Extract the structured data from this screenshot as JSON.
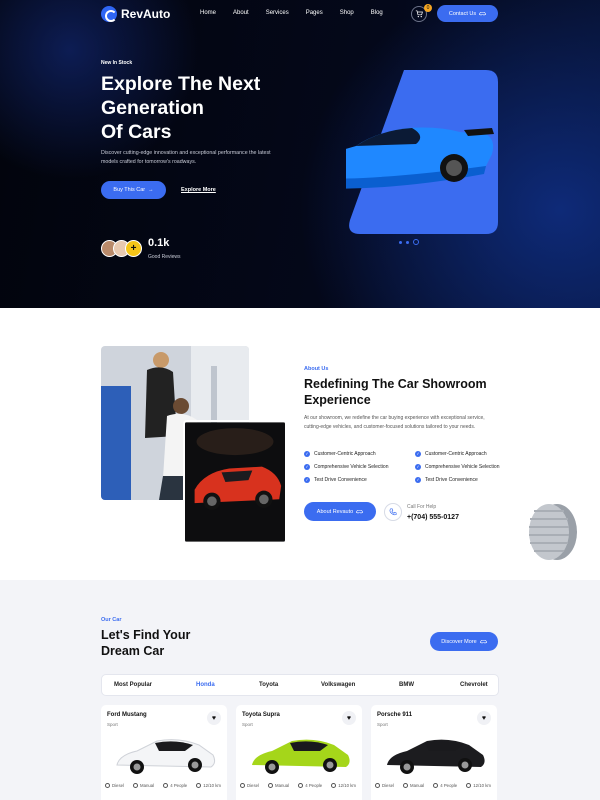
{
  "brand": {
    "name": "RevAuto",
    "accent": "#3b6cf0"
  },
  "nav": {
    "items": [
      "Home",
      "About",
      "Services",
      "Pages",
      "Shop",
      "Blog"
    ],
    "cart_count": "0",
    "contact_label": "Contact Us"
  },
  "hero": {
    "eyebrow": "New In Stock",
    "title_lines": [
      "Explore The Next",
      "Generation",
      "Of Cars"
    ],
    "description": "Discover cutting-edge innovation and exceptional performance the latest models crafted for tomorrow's roadways.",
    "buy_label": "Buy This Car",
    "explore_label": "Explore More",
    "reviews_count": "0.1k",
    "reviews_label": "Good Reviews"
  },
  "about": {
    "eyebrow": "About Us",
    "title": "Redefining The Car Showroom Experience",
    "description": "At our showroom, we redefine the car buying experience with exceptional service, cutting-edge vehicles, and customer-focused solutions tailored to your needs.",
    "features": [
      "Customer-Centric Approach",
      "Customer-Centric Approach",
      "Comprehensive Vehicle Selection",
      "Comprehensive Vehicle Selection",
      "Test Drive Convenience",
      "Test Drive Convenience"
    ],
    "button_label": "About Revauto",
    "call_label": "Call For Help",
    "call_number": "+(704) 555-0127"
  },
  "cars": {
    "eyebrow": "Our Car",
    "title_lines": [
      "Let's Find Your",
      "Dream Car"
    ],
    "discover_label": "Discover More",
    "tabs": [
      "Most Popular",
      "Honda",
      "Toyota",
      "Volkswagen",
      "BMW",
      "Chevrolet"
    ],
    "active_tab": "Honda",
    "items": [
      {
        "name": "Ford Mustang",
        "type": "Sport",
        "color": "#f4f5f7",
        "specs": [
          "Diesel",
          "Manual",
          "4 People",
          "12/10 km"
        ]
      },
      {
        "name": "Toyota Supra",
        "type": "Sport",
        "color": "#a5d61a",
        "specs": [
          "Diesel",
          "Manual",
          "4 People",
          "12/10 km"
        ]
      },
      {
        "name": "Porsche 911",
        "type": "Sport",
        "color": "#1c1c1f",
        "specs": [
          "Diesel",
          "Manual",
          "4 People",
          "12/10 km"
        ]
      }
    ]
  }
}
